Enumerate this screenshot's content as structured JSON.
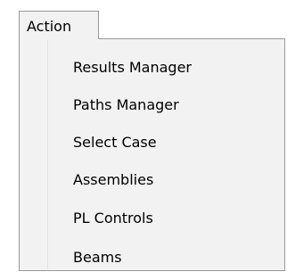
{
  "menu": {
    "title": "Action",
    "items": [
      {
        "label": "Results Manager"
      },
      {
        "label": "Paths Manager"
      },
      {
        "label": "Select Case"
      },
      {
        "label": "Assemblies"
      },
      {
        "label": "PL Controls"
      },
      {
        "label": "Beams"
      }
    ]
  },
  "colors": {
    "menu_background": "#f2f2f2",
    "border": "#999999",
    "text": "#000000"
  }
}
